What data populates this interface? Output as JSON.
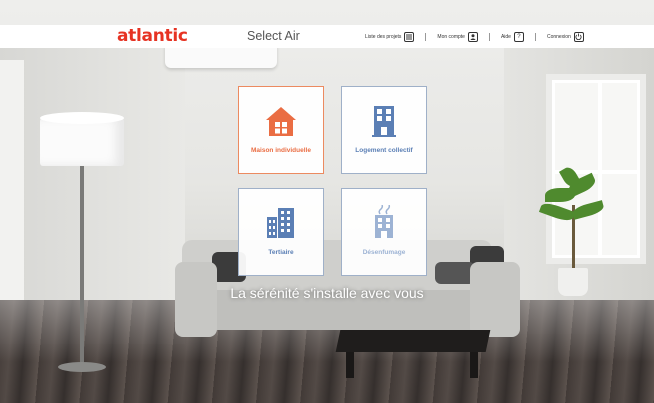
{
  "header": {
    "logo": "atlantic",
    "app_title": "Select Air",
    "nav": [
      {
        "label": "Liste des projets",
        "icon": "list-icon"
      },
      {
        "label": "Mon compte",
        "icon": "user-icon"
      },
      {
        "label": "Aide",
        "icon": "help-icon",
        "glyph": "?"
      },
      {
        "label": "Connexion",
        "icon": "power-icon"
      }
    ]
  },
  "tiles": [
    {
      "label": "Maison individuelle",
      "icon": "house-icon",
      "state": "active"
    },
    {
      "label": "Logement collectif",
      "icon": "apartment-building-icon",
      "state": "normal"
    },
    {
      "label": "Tertiaire",
      "icon": "office-buildings-icon",
      "state": "normal"
    },
    {
      "label": "Désenfumage",
      "icon": "smoke-extraction-building-icon",
      "state": "faded"
    }
  ],
  "tagline": "La sérénité s'installe avec vous",
  "colors": {
    "brand": "#e63323",
    "active_tile": "#ea6d43",
    "tile_blue": "#5b7fb5",
    "faded_blue": "#9db3d4"
  }
}
